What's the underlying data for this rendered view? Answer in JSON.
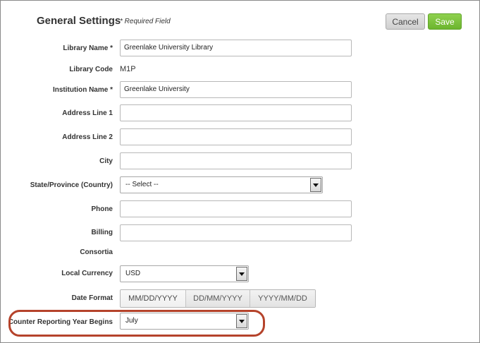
{
  "header": {
    "title": "General Settings",
    "required_note": "* Required Field",
    "cancel_label": "Cancel",
    "save_label": "Save"
  },
  "fields": {
    "library_name": {
      "label": "Library Name *",
      "value": "Greenlake University Library"
    },
    "library_code": {
      "label": "Library Code",
      "value": "M1P"
    },
    "institution_name": {
      "label": "Institution Name *",
      "value": "Greenlake University"
    },
    "address_line_1": {
      "label": "Address Line 1",
      "value": ""
    },
    "address_line_2": {
      "label": "Address Line 2",
      "value": ""
    },
    "city": {
      "label": "City",
      "value": ""
    },
    "state_province": {
      "label": "State/Province (Country)",
      "value": "-- Select --"
    },
    "phone": {
      "label": "Phone",
      "value": ""
    },
    "billing": {
      "label": "Billing",
      "value": ""
    },
    "consortia": {
      "label": "Consortia"
    },
    "local_currency": {
      "label": "Local Currency",
      "value": "USD"
    },
    "date_format": {
      "label": "Date Format",
      "options": [
        "MM/DD/YYYY",
        "DD/MM/YYYY",
        "YYYY/MM/DD"
      ],
      "selected": "MM/DD/YYYY"
    },
    "counter_year": {
      "label": "Counter Reporting Year Begins",
      "value": "July"
    }
  },
  "colors": {
    "save_button": "#78c23a",
    "highlight_ring": "#b5432b"
  },
  "icons": {
    "dropdown": "chevron-down-icon"
  }
}
